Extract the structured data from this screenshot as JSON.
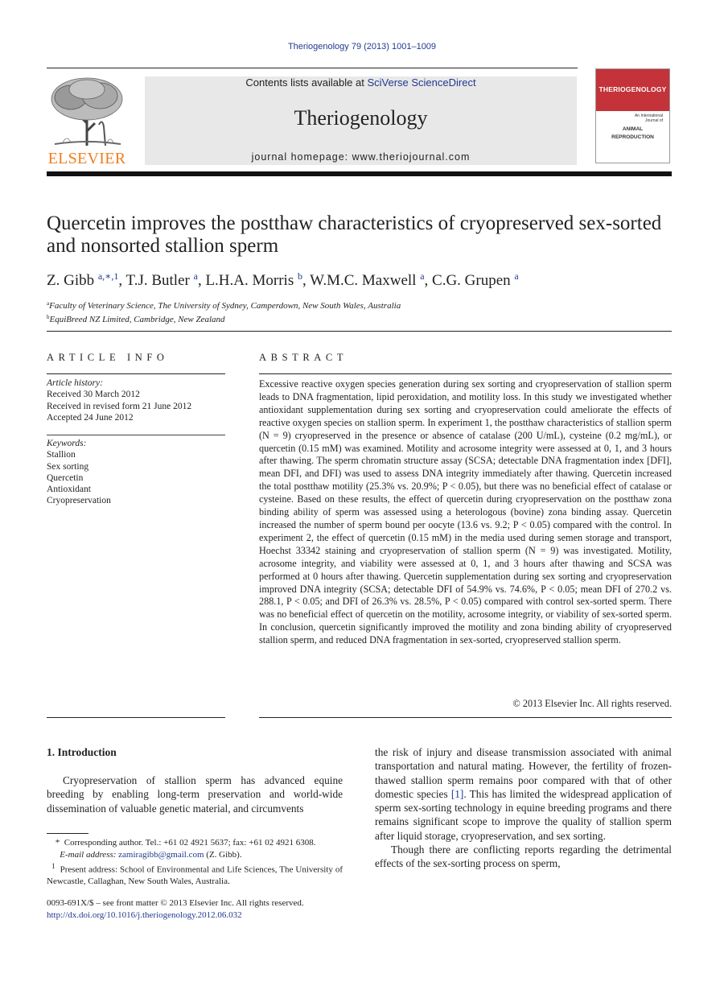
{
  "running_head": "Theriogenology 79 (2013) 1001–1009",
  "publisher": {
    "logo_word": "ELSEVIER",
    "brand_color": "#f07e1f"
  },
  "banner": {
    "contents_prefix": "Contents lists available at ",
    "contents_link": "SciVerse ScienceDirect",
    "journal_name": "Theriogenology",
    "homepage_prefix": "journal homepage: ",
    "homepage_url": "www.theriojournal.com"
  },
  "cover": {
    "title": "THERIOGENOLOGY",
    "subtitle": "An International Journal of",
    "line1": "ANIMAL",
    "line2": "REPRODUCTION",
    "color": "#c4333a"
  },
  "article": {
    "title": "Quercetin improves the postthaw characteristics of cryopreserved sex-sorted and nonsorted stallion sperm",
    "authors": [
      {
        "name": "Z. Gibb",
        "sup": "a,∗,1"
      },
      {
        "name": "T.J. Butler",
        "sup": "a"
      },
      {
        "name": "L.H.A. Morris",
        "sup": "b"
      },
      {
        "name": "W.M.C. Maxwell",
        "sup": "a"
      },
      {
        "name": "C.G. Grupen",
        "sup": "a"
      }
    ],
    "affiliations": [
      {
        "mark": "a",
        "text": "Faculty of Veterinary Science, The University of Sydney, Camperdown, New South Wales, Australia"
      },
      {
        "mark": "b",
        "text": "EquiBreed NZ Limited, Cambridge, New Zealand"
      }
    ]
  },
  "article_info": {
    "heading": "ARTICLE INFO",
    "history_label": "Article history:",
    "history": [
      "Received 30 March 2012",
      "Received in revised form 21 June 2012",
      "Accepted 24 June 2012"
    ],
    "keywords_label": "Keywords:",
    "keywords": [
      "Stallion",
      "Sex sorting",
      "Quercetin",
      "Antioxidant",
      "Cryopreservation"
    ]
  },
  "abstract": {
    "heading": "ABSTRACT",
    "text": "Excessive reactive oxygen species generation during sex sorting and cryopreservation of stallion sperm leads to DNA fragmentation, lipid peroxidation, and motility loss. In this study we investigated whether antioxidant supplementation during sex sorting and cryopreservation could ameliorate the effects of reactive oxygen species on stallion sperm. In experiment 1, the postthaw characteristics of stallion sperm (N = 9) cryopreserved in the presence or absence of catalase (200 U/mL), cysteine (0.2 mg/mL), or quercetin (0.15 mM) was examined. Motility and acrosome integrity were assessed at 0, 1, and 3 hours after thawing. The sperm chromatin structure assay (SCSA; detectable DNA frag­mentation index [DFI], mean DFI, and DFI) was used to assess DNA integrity immediately after thawing. Quercetin increased the total postthaw motility (25.3% vs. 20.9%; P < 0.05), but there was no beneficial effect of catalase or cysteine. Based on these results, the effect of quercetin during cryopreservation on the postthaw zona binding ability of sperm was assessed using a heterologous (bovine) zona binding assay. Quercetin increased the number of sperm bound per oocyte (13.6 vs. 9.2; P < 0.05) compared with the control. In experiment 2, the effect of quercetin (0.15 mM) in the media used during semen storage and transport, Hoechst 33342 staining and cryopreservation of stallion sperm (N = 9) was investigated. Motility, acrosome integrity, and viability were assessed at 0, 1, and 3 hours after thawing and SCSA was performed at 0 hours after thawing. Quercetin supplemen­tation during sex sorting and cryopreservation improved DNA integrity (SCSA; detectable DFI of 54.9% vs. 74.6%, P < 0.05; mean DFI of 270.2 vs. 288.1, P < 0.05; and DFI of 26.3% vs. 28.5%, P < 0.05) compared with control sex-sorted sperm. There was no beneficial effect of quercetin on the motility, acrosome integrity, or viability of sex-sorted sperm. In conclu­sion, quercetin significantly improved the motility and zona binding ability of cry­opreserved stallion sperm, and reduced DNA fragmentation in sex-sorted, cryopreserved stallion sperm.",
    "copyright": "© 2013 Elsevier Inc. All rights reserved."
  },
  "introduction": {
    "heading": "1.  Introduction",
    "col1_para1": "Cryopreservation of stallion sperm has advanced equine breeding by enabling long-term preservation and world-wide dissemination of valuable genetic material, and circumvents",
    "col2_para1_a": "the risk of injury and disease transmission associated with animal transportation and natural mating. However, the fertility of frozen-thawed stallion sperm remains poor compared with that of other domestic species ",
    "col2_ref": "[1]",
    "col2_para1_b": ". This has limited the widespread application of sperm sex-sorting technology in equine breeding programs and there remains significant scope to improve the quality of stallion sperm after liquid storage, cryopreservation, and sex sorting.",
    "col2_para2": "Though there are conflicting reports regarding the detrimental effects of the sex-sorting process on sperm,"
  },
  "footnotes": {
    "corresponding_mark": "*",
    "corresponding": "Corresponding author. Tel.: +61 02 4921 5637; fax: +61 02 4921 6308.",
    "email_label": "E-mail address: ",
    "email": "zamiragibb@gmail.com",
    "email_suffix": " (Z. Gibb).",
    "present_mark": "1",
    "present": "Present address: School of Environmental and Life Sciences, The University of Newcastle, Callaghan, New South Wales, Australia."
  },
  "front_matter": {
    "issn": "0093-691X/$ – see front matter © 2013 Elsevier Inc. All rights reserved.",
    "doi": "http://dx.doi.org/10.1016/j.theriogenology.2012.06.032"
  }
}
